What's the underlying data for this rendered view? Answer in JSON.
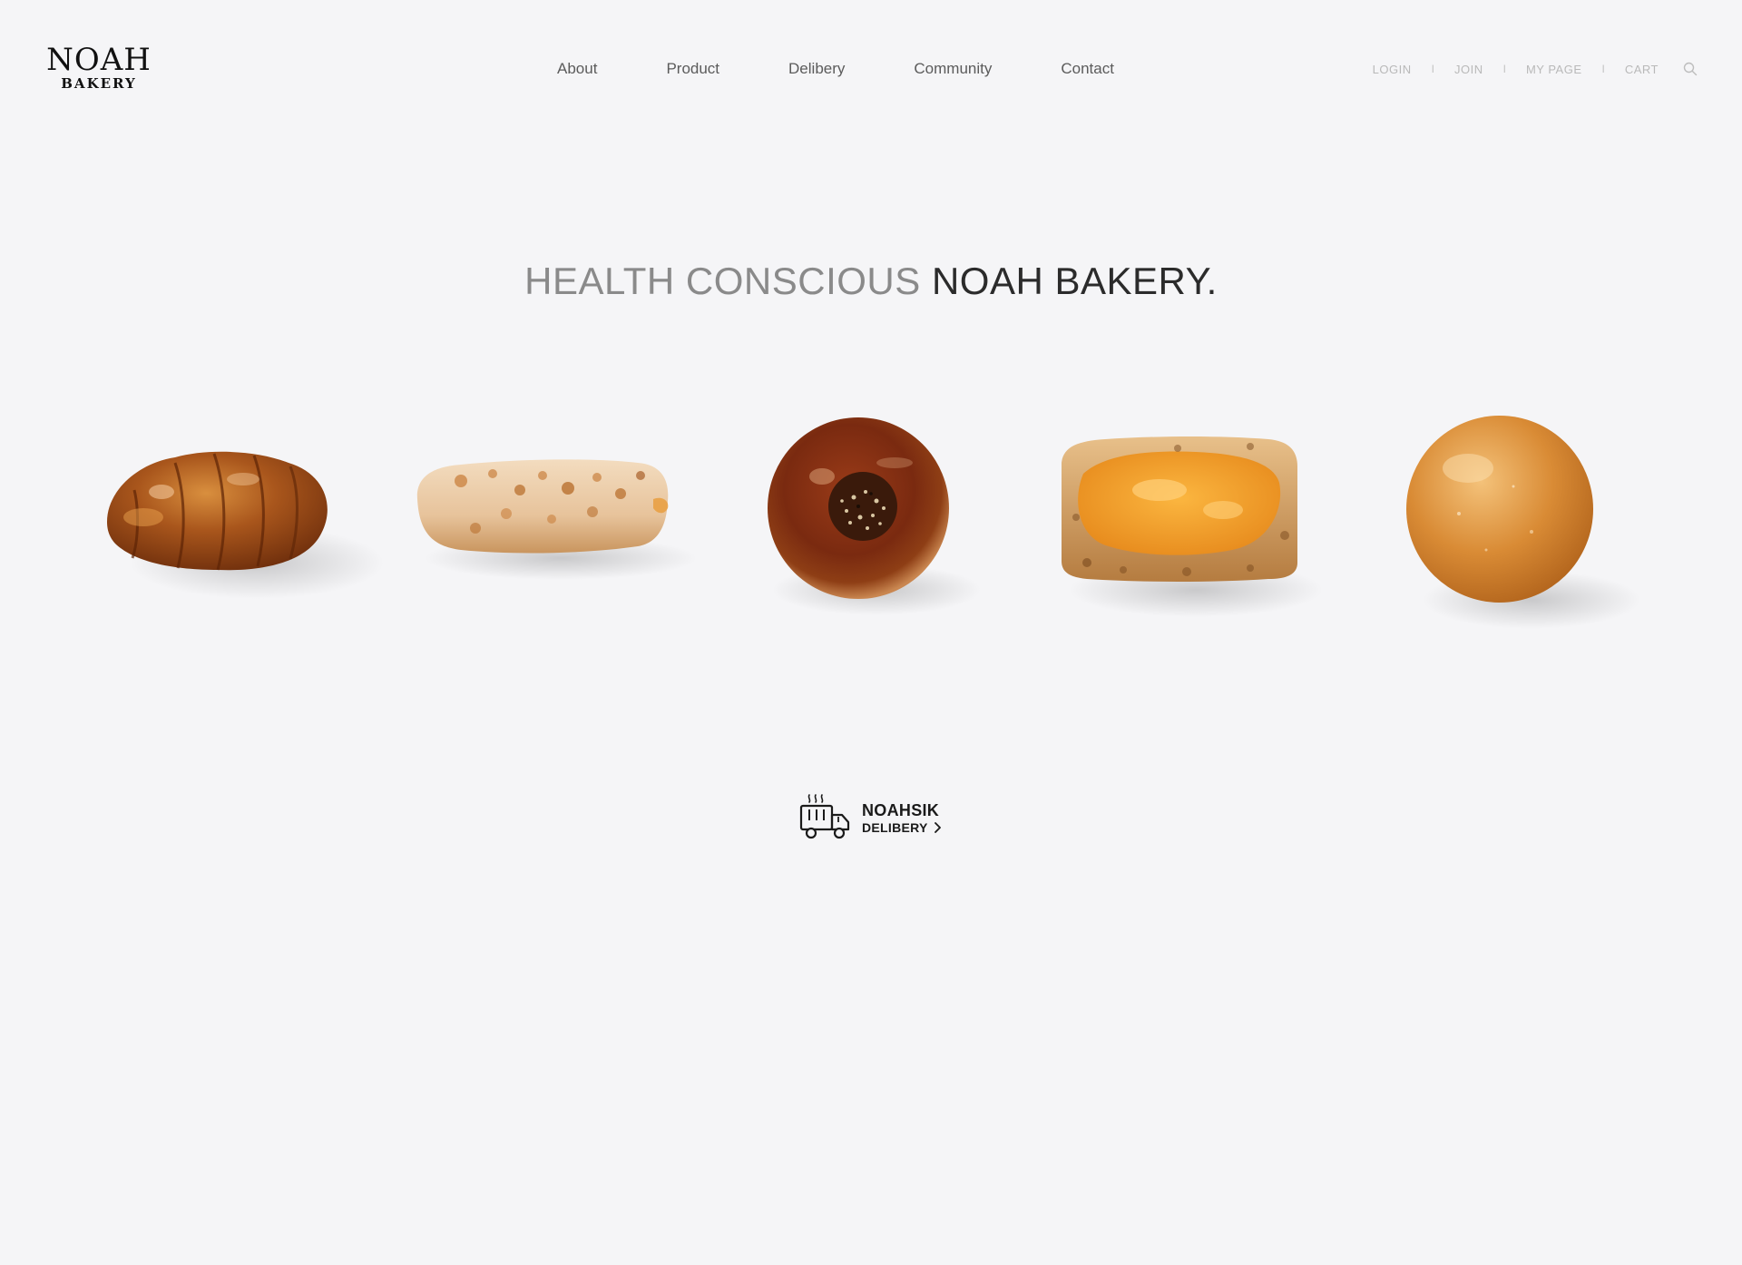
{
  "header": {
    "logo": {
      "main": "NOAH",
      "sub": "BAKERY"
    },
    "main_nav": [
      {
        "label": "About"
      },
      {
        "label": "Product"
      },
      {
        "label": "Delibery"
      },
      {
        "label": "Community"
      },
      {
        "label": "Contact"
      }
    ],
    "util_nav": {
      "login": "LOGIN",
      "join": "JOIN",
      "mypage": "MY PAGE",
      "cart": "CART",
      "separator": "I",
      "search_icon": "search-icon"
    }
  },
  "hero": {
    "title_light": "HEALTH CONSCIOUS ",
    "title_dark": "NOAH BAKERY."
  },
  "breads": [
    {
      "kind": "croissant"
    },
    {
      "kind": "baguette-roll"
    },
    {
      "kind": "sesame-bun"
    },
    {
      "kind": "cheese-bread"
    },
    {
      "kind": "round-bun"
    }
  ],
  "delivery": {
    "brand": "NOAHSIK",
    "label": "DELIBERY",
    "truck_icon": "delivery-truck-icon",
    "arrow_icon": "chevron-right-icon"
  },
  "colors": {
    "background": "#f5f5f7",
    "nav_text": "#5b5b5b",
    "util_text": "#b9b9b9",
    "hero_light": "#8a8a8a",
    "hero_dark": "#2b2b2b"
  }
}
